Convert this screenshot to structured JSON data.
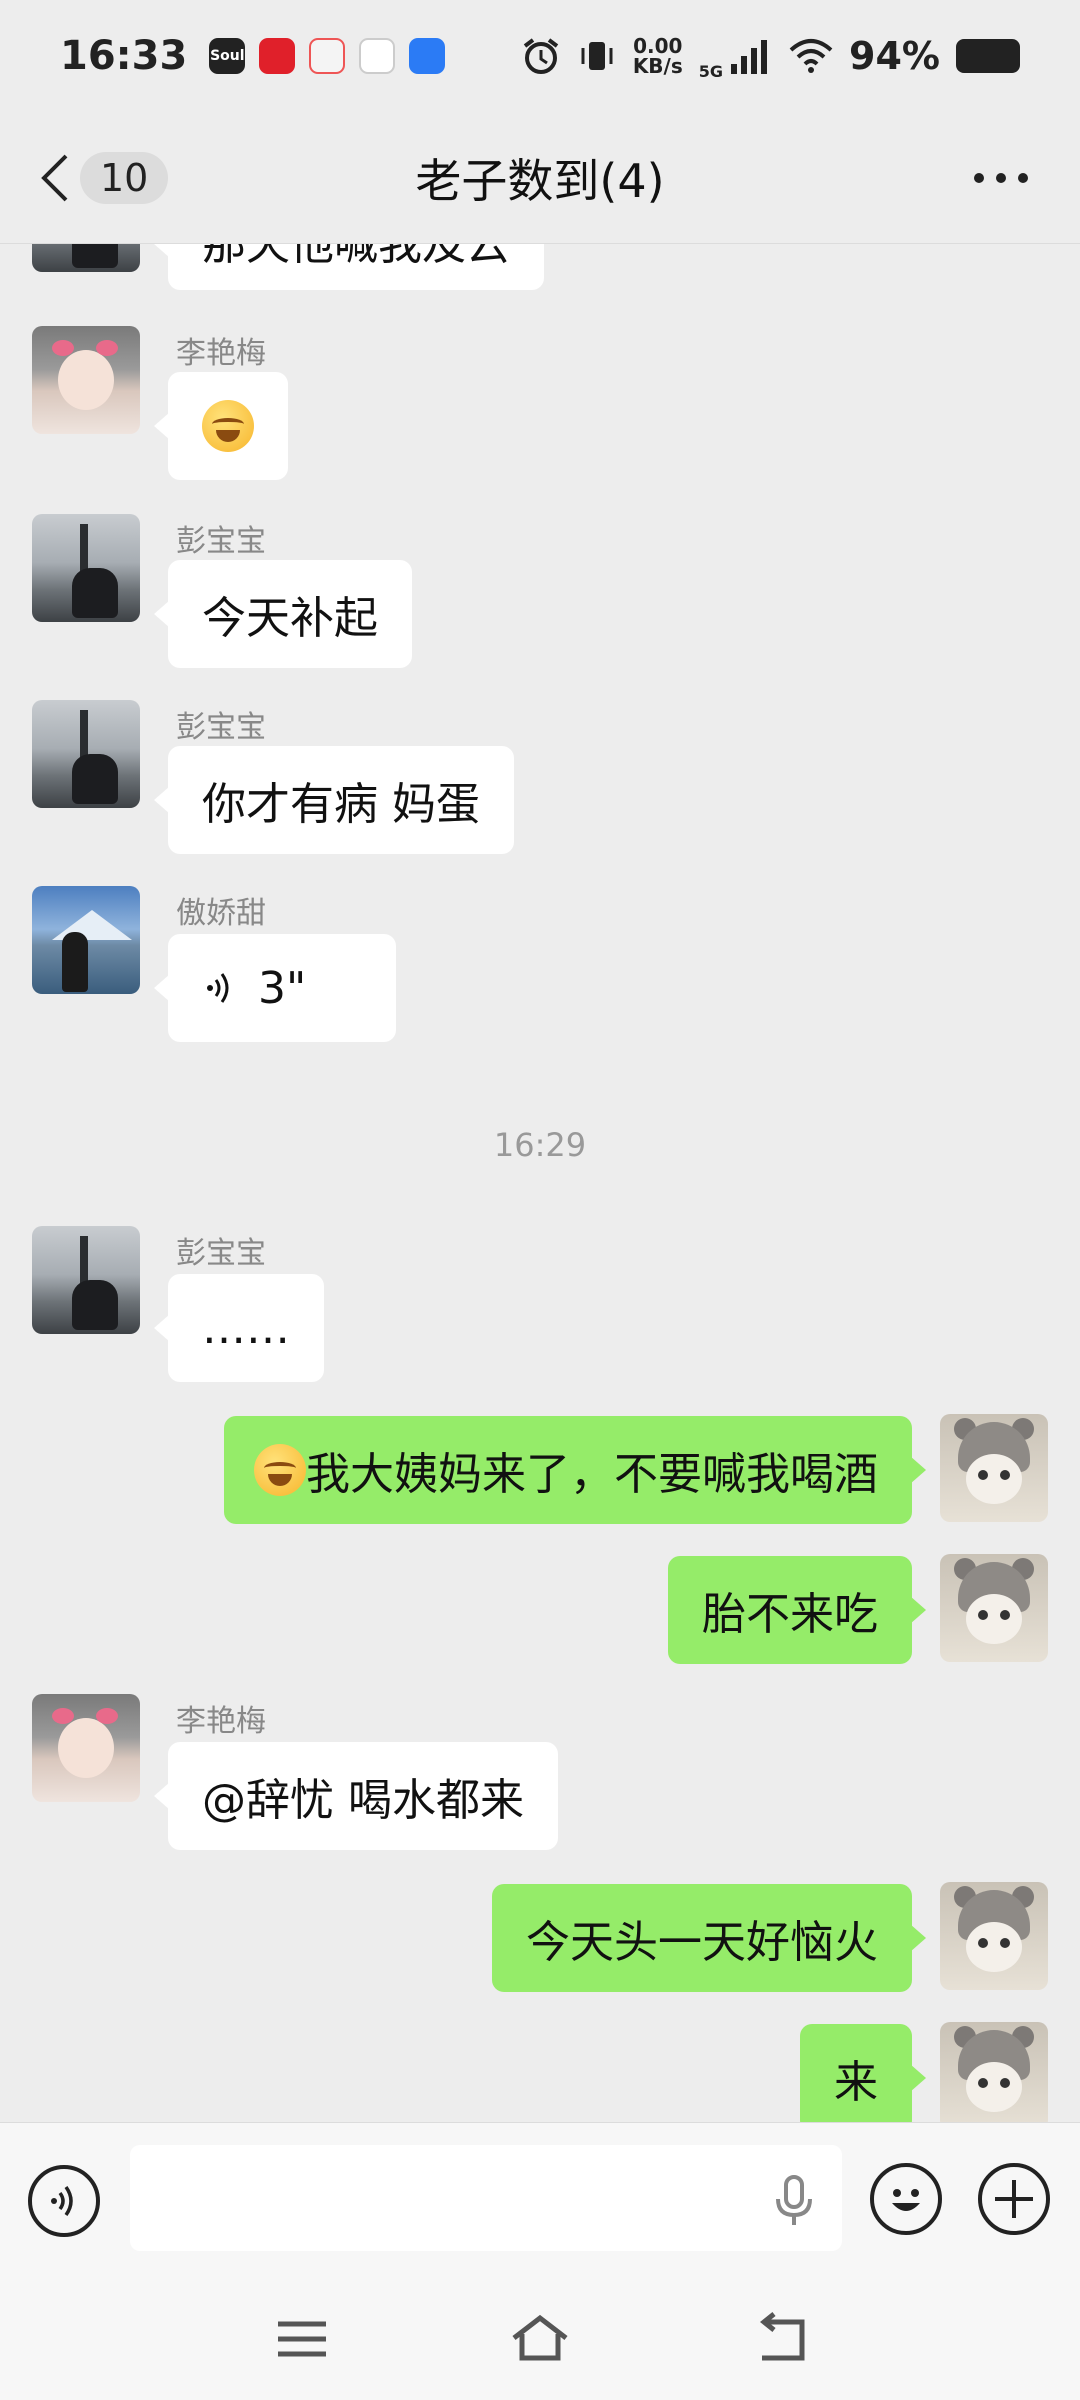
{
  "status_bar": {
    "time": "16:33",
    "apps": [
      "Soul",
      "",
      "",
      "",
      ""
    ],
    "net_speed_value": "0.00",
    "net_speed_unit": "KB/s",
    "network": "5G",
    "battery": "94%"
  },
  "header": {
    "unread_count": "10",
    "title": "老子数到(4)"
  },
  "messages": {
    "m0": {
      "text": "那天他喊我及云"
    },
    "m1": {
      "sender": "李艳梅"
    },
    "m2": {
      "sender": "彭宝宝",
      "text": "今天补起"
    },
    "m3": {
      "sender": "彭宝宝",
      "text": "你才有病 妈蛋"
    },
    "m4": {
      "sender": "傲娇甜",
      "voice_duration": "3\""
    },
    "timestamp": "16:29",
    "m5": {
      "sender": "彭宝宝",
      "text": "……"
    },
    "m6": {
      "text": "我大姨妈来了，不要喊我喝酒"
    },
    "m7": {
      "text": "胎不来吃"
    },
    "m8": {
      "sender": "李艳梅",
      "text": "@辞忧  喝水都来"
    },
    "m9": {
      "text": "今天头一天好恼火"
    },
    "m10": {
      "text": "来"
    }
  },
  "input": {
    "value": "",
    "placeholder": ""
  },
  "colors": {
    "outgoing_bubble": "#95ec69",
    "incoming_bubble": "#ffffff",
    "background": "#ededed"
  }
}
